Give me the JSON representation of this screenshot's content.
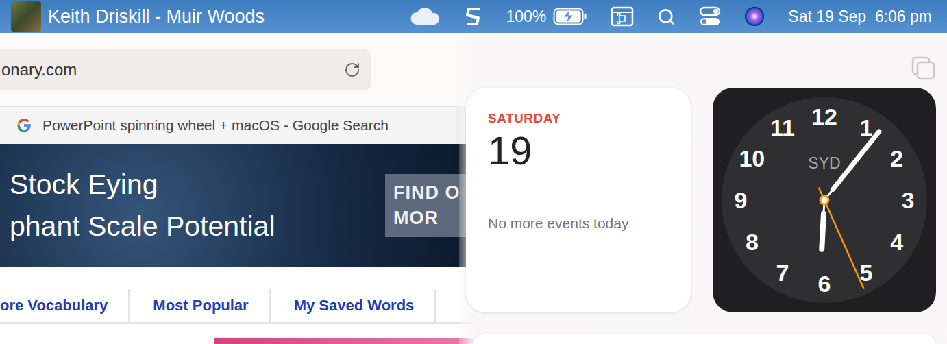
{
  "menu_bar": {
    "now_playing": "Keith Driskill - Muir Woods",
    "battery": {
      "reading": "100%",
      "level": 1,
      "charging": true
    },
    "clock": "Sat 19 Sep  6:06 pm"
  },
  "browser": {
    "address": "onary.com",
    "tab": {
      "title": "PowerPoint spinning wheel + macOS - Google Search"
    },
    "banner": {
      "headline": [
        "Stock Eying",
        "phant Scale Potential"
      ],
      "button": [
        "FIND O",
        "MOR"
      ]
    },
    "nav_links": [
      {
        "label": "ore Vocabulary"
      },
      {
        "label": "Most Popular"
      },
      {
        "label": "My Saved Words"
      }
    ]
  },
  "widgets": {
    "calendar": {
      "day": "SATURDAY",
      "date": "19",
      "message": "No more events today"
    },
    "clock": {
      "city": "SYD",
      "numerals": [
        "12",
        "1",
        "2",
        "3",
        "4",
        "5",
        "6",
        "7",
        "8",
        "9",
        "10",
        "11"
      ],
      "hour": 6,
      "minute": 6,
      "second": 26
    }
  }
}
